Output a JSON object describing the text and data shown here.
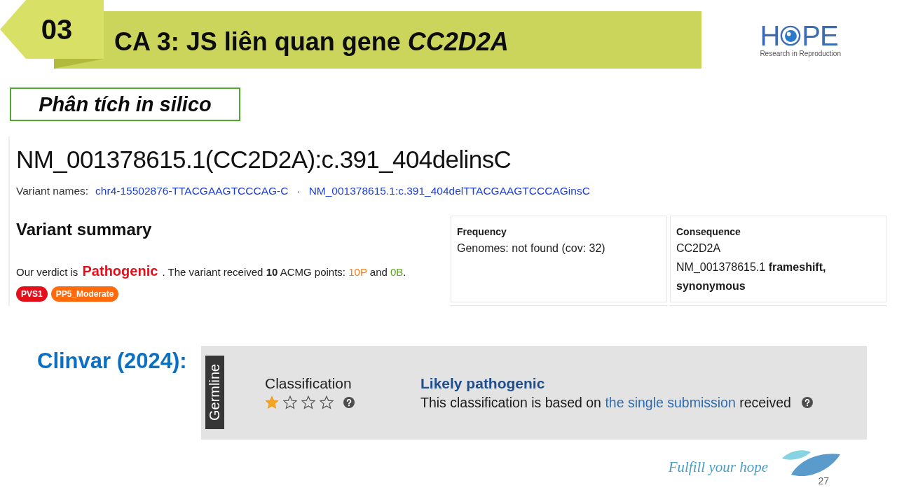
{
  "slide_header": {
    "number": "03",
    "title": "CA 3: JS liên quan gene *CC2D2A*"
  },
  "logo": {
    "wordmark_start": "H",
    "wordmark_end": "PE",
    "tagline": "Research in Reproduction"
  },
  "section_label": "Phân tích in silico",
  "variant_page": {
    "title": "NM_001378615.1(CC2D2A):c.391_404delinsC",
    "variant_names": {
      "label": "Variant names:",
      "links": [
        "chr4-15502876-TTACGAAGTCCCAG-C",
        "NM_001378615.1:c.391_404delTTACGAAGTCCCAGinsC"
      ],
      "separator": "·"
    },
    "summary": {
      "heading": "Variant summary",
      "verdict_line": [
        {
          "kind": "plain",
          "text": "Our verdict is "
        },
        {
          "kind": "verdict",
          "text": "Pathogenic"
        },
        {
          "kind": "plain",
          "text": " . The variant received **10** ACMG points: "
        },
        {
          "kind": "pathogenic_points",
          "text": "10P"
        },
        {
          "kind": "plain",
          "text": " and "
        },
        {
          "kind": "benign_points",
          "text": "0B"
        },
        {
          "kind": "plain",
          "text": "."
        }
      ],
      "criteria": [
        {
          "label": "PVS1",
          "color": "#e3101c"
        },
        {
          "label": "PP5_Moderate",
          "color": "#ff6a0d"
        }
      ]
    },
    "cards": [
      {
        "title": "Frequency",
        "lines": [
          "Genomes: not found (cov: 32)"
        ]
      },
      {
        "title": "Consequence",
        "lines": [
          "CC2D2A",
          "NM_001378615.1 **frameshift, synonymous**"
        ]
      }
    ]
  },
  "clinvar": {
    "label": "Clinvar (2024):",
    "panel": {
      "origin_tag": "Germline",
      "classification_label": "Classification",
      "stars": 1,
      "result": "Likely pathogenic",
      "basis": {
        "before": "This classification is based on",
        "link": "the single submission",
        "after": "received"
      }
    }
  },
  "footer": {
    "motto": "Fulfill your hope",
    "page_number": "27"
  }
}
